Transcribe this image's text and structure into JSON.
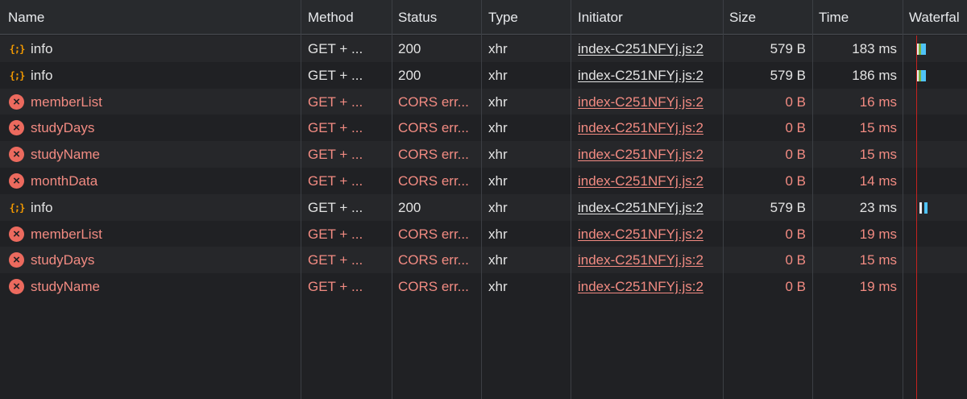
{
  "columns": {
    "name": "Name",
    "method": "Method",
    "status": "Status",
    "type": "Type",
    "initiator": "Initiator",
    "size": "Size",
    "time": "Time",
    "waterfall": "Waterfal"
  },
  "colors": {
    "error": "#f28b82",
    "xhr_icon": "#f29900",
    "error_icon": "#ec6a5e",
    "waterfall_wait": "#7cb342",
    "waterfall_download": "#4fc3f7",
    "waterfall_marker": "#c5221f"
  },
  "requests": [
    {
      "name": "info",
      "icon": "xhr-icon",
      "method": "GET + ...",
      "status": "200",
      "type": "xhr",
      "initiator": "index-C251NFYj.js:2",
      "size": "579 B",
      "time": "183 ms",
      "error": false,
      "waterfall": true
    },
    {
      "name": "info",
      "icon": "xhr-icon",
      "method": "GET + ...",
      "status": "200",
      "type": "xhr",
      "initiator": "index-C251NFYj.js:2",
      "size": "579 B",
      "time": "186 ms",
      "error": false,
      "waterfall": true
    },
    {
      "name": "memberList",
      "icon": "error-icon",
      "method": "GET + ...",
      "status": "CORS err...",
      "type": "xhr",
      "initiator": "index-C251NFYj.js:2",
      "size": "0 B",
      "time": "16 ms",
      "error": true,
      "waterfall": false
    },
    {
      "name": "studyDays",
      "icon": "error-icon",
      "method": "GET + ...",
      "status": "CORS err...",
      "type": "xhr",
      "initiator": "index-C251NFYj.js:2",
      "size": "0 B",
      "time": "15 ms",
      "error": true,
      "waterfall": false
    },
    {
      "name": "studyName",
      "icon": "error-icon",
      "method": "GET + ...",
      "status": "CORS err...",
      "type": "xhr",
      "initiator": "index-C251NFYj.js:2",
      "size": "0 B",
      "time": "15 ms",
      "error": true,
      "waterfall": false
    },
    {
      "name": "monthData",
      "icon": "error-icon",
      "method": "GET + ...",
      "status": "CORS err...",
      "type": "xhr",
      "initiator": "index-C251NFYj.js:2",
      "size": "0 B",
      "time": "14 ms",
      "error": true,
      "waterfall": false
    },
    {
      "name": "info",
      "icon": "xhr-icon",
      "method": "GET + ...",
      "status": "200",
      "type": "xhr",
      "initiator": "index-C251NFYj.js:2",
      "size": "579 B",
      "time": "23 ms",
      "error": false,
      "waterfall": true
    },
    {
      "name": "memberList",
      "icon": "error-icon",
      "method": "GET + ...",
      "status": "CORS err...",
      "type": "xhr",
      "initiator": "index-C251NFYj.js:2",
      "size": "0 B",
      "time": "19 ms",
      "error": true,
      "waterfall": false
    },
    {
      "name": "studyDays",
      "icon": "error-icon",
      "method": "GET + ...",
      "status": "CORS err...",
      "type": "xhr",
      "initiator": "index-C251NFYj.js:2",
      "size": "0 B",
      "time": "15 ms",
      "error": true,
      "waterfall": false
    },
    {
      "name": "studyName",
      "icon": "error-icon",
      "method": "GET + ...",
      "status": "CORS err...",
      "type": "xhr",
      "initiator": "index-C251NFYj.js:2",
      "size": "0 B",
      "time": "19 ms",
      "error": true,
      "waterfall": false
    }
  ]
}
